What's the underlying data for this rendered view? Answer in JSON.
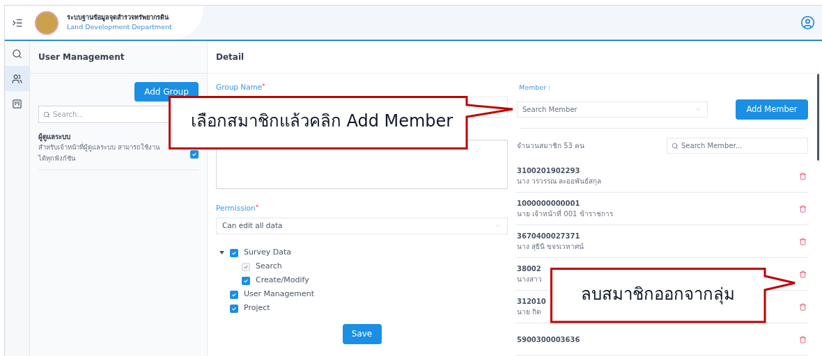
{
  "header": {
    "title": "ระบบฐานข้อมูลจุดสำรวจทรัพยากรดิน",
    "subtitle": "Land Development Department"
  },
  "rail": [
    {
      "kind": "search",
      "selected": false
    },
    {
      "kind": "users",
      "selected": true
    },
    {
      "kind": "board",
      "selected": false
    }
  ],
  "user_panel": {
    "title": "User Management",
    "add_button": "Add Group",
    "search_placeholder": "Search...",
    "groups": [
      {
        "name": "ผู้ดูแลระบบ",
        "description": "สำหรับเจ้าหน้าที่ผู้ดูแลระบบ สามารถใช้งานได้ทุกฟังก์ชัน",
        "checked": true
      }
    ]
  },
  "detail": {
    "title": "Detail",
    "group_name": {
      "label": "Group Name",
      "required_mark": "*"
    },
    "permission": {
      "label": "Permission",
      "required_mark": "*",
      "value": "Can edit all data"
    },
    "tree": [
      {
        "label": "Survey Data",
        "checked": true,
        "disabled": false,
        "expanded": true,
        "children": [
          {
            "label": "Search",
            "checked": true,
            "disabled": true
          },
          {
            "label": "Create/Modify",
            "checked": true,
            "disabled": false
          }
        ]
      },
      {
        "label": "User Management",
        "checked": true,
        "disabled": false
      },
      {
        "label": "Project",
        "checked": true,
        "disabled": false
      }
    ],
    "save_button": "Save",
    "member": {
      "label": "Member :",
      "select_placeholder": "Search Member",
      "add_button": "Add Member",
      "count": "จำนวนสมาชิก 53 คน",
      "search_placeholder": "Search Member...",
      "rows": [
        {
          "id": "3100201902293",
          "name": "นาง วรวรรณ ละออพันธ์สกุล"
        },
        {
          "id": "1000000000001",
          "name": "นาย เจ้าหน้าที่ 001 ข้าราชการ"
        },
        {
          "id": "3670400027371",
          "name": "นาง สุธินี ขจรเวหาศน์"
        },
        {
          "id": "38002",
          "name": "นางสาว"
        },
        {
          "id": "312010",
          "name": "นาย กิต"
        },
        {
          "id": "5900300003636",
          "name": ""
        }
      ]
    }
  },
  "callouts": [
    {
      "text": "เลือกสมาชิกแล้วคลิก Add Member"
    },
    {
      "text": "ลบสมาชิกออกจากลุ่ม"
    }
  ]
}
